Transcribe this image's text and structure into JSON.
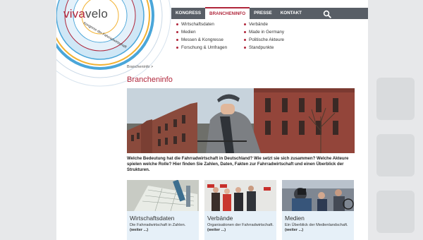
{
  "logo": {
    "viva": "viva",
    "velo": "velo",
    "subtitle": "Kongress der Fahrradwirtschaft"
  },
  "nav": {
    "items": [
      {
        "label": "KONGRESS",
        "active": false
      },
      {
        "label": "BRANCHENINFO",
        "active": true
      },
      {
        "label": "PRESSE",
        "active": false
      },
      {
        "label": "KONTAKT",
        "active": false
      }
    ],
    "search_icon": "search-icon"
  },
  "submenu": {
    "col1": [
      "Wirtschaftsdaten",
      "Medien",
      "Messen & Kongresse",
      "Forschung & Umfragen"
    ],
    "col2": [
      "Verbände",
      "Made in Germany",
      "Politische Akteure",
      "Standpunkte"
    ]
  },
  "breadcrumb": "Brancheninfo >",
  "page_title": "Brancheninfo",
  "intro": "Welche Bedeutung hat die Fahrradwirtschaft in Deutschland? Wie setzt sie sich zusammen? Welche Akteure spielen welche Rolle? Hier finden Sie Zahlen, Daten, Fakten zur Fahrradwirtschaft und einen Überblick der Strukturen.",
  "cards": [
    {
      "title": "Wirtschaftsdaten",
      "desc": "Die Fahrradwirtschaft in Zahlen.",
      "more": "(weiter ...)"
    },
    {
      "title": "Verbände",
      "desc": "Organisationen der Fahrradwirtschaft.",
      "more": "(weiter ...)"
    },
    {
      "title": "Medien",
      "desc": "Ein Überblick der Medienlandschaft.",
      "more": "(weiter ...)"
    }
  ],
  "colors": {
    "accent": "#b0263b",
    "nav_bg": "#585e66",
    "card_bg": "#e6f0f8"
  }
}
